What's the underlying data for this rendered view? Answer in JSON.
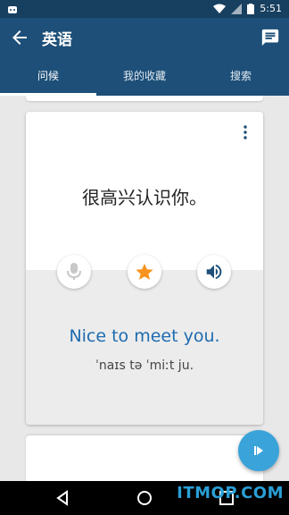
{
  "status_bar": {
    "time": "5:51"
  },
  "app_bar": {
    "title": "英语"
  },
  "tabs": [
    {
      "label": "问候",
      "active": true
    },
    {
      "label": "我的收藏",
      "active": false
    },
    {
      "label": "搜索",
      "active": false
    }
  ],
  "card": {
    "phrase": "很高兴认识你。",
    "translation": "Nice to meet you.",
    "phonetic": "ˈnaɪs tə ˈmiːt ju."
  },
  "icons": {
    "mic": "microphone-icon",
    "star": "star-icon",
    "speaker": "speaker-icon",
    "play": "play-icon"
  },
  "colors": {
    "app_bar": "#1d4f78",
    "translation": "#1d6bb0",
    "star": "#f7931e",
    "fab": "#3aa3da"
  },
  "watermark": "ITMOP.COM"
}
